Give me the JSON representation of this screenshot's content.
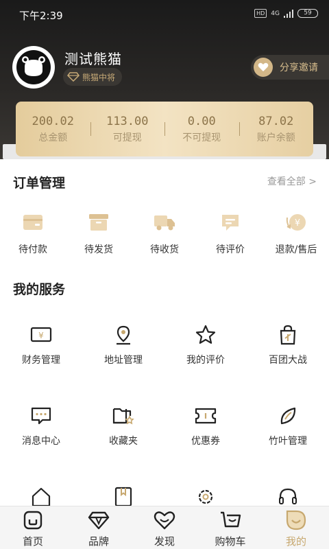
{
  "status_bar": {
    "time": "下午2:39",
    "hd": "HD",
    "network": "4G",
    "battery": "59"
  },
  "profile": {
    "username": "测试熊猫",
    "rank": "熊猫中将",
    "invite_label": "分享邀请"
  },
  "wallet": [
    {
      "value": "200.02",
      "label": "总金额"
    },
    {
      "value": "113.00",
      "label": "可提现"
    },
    {
      "value": "0.00",
      "label": "不可提现"
    },
    {
      "value": "87.02",
      "label": "账户余额"
    }
  ],
  "orders": {
    "title": "订单管理",
    "view_all": "查看全部 >",
    "items": [
      {
        "label": "待付款",
        "icon": "wallet-icon"
      },
      {
        "label": "待发货",
        "icon": "box-icon"
      },
      {
        "label": "待收货",
        "icon": "truck-icon"
      },
      {
        "label": "待评价",
        "icon": "comment-icon"
      },
      {
        "label": "退款/售后",
        "icon": "refund-icon"
      }
    ]
  },
  "services": {
    "title": "我的服务",
    "items": [
      {
        "label": "财务管理",
        "icon": "finance-icon"
      },
      {
        "label": "地址管理",
        "icon": "location-pin-icon"
      },
      {
        "label": "我的评价",
        "icon": "star-icon"
      },
      {
        "label": "百团大战",
        "icon": "shopping-bag-icon"
      },
      {
        "label": "消息中心",
        "icon": "message-icon"
      },
      {
        "label": "收藏夹",
        "icon": "folder-star-icon"
      },
      {
        "label": "优惠券",
        "icon": "coupon-icon"
      },
      {
        "label": "竹叶管理",
        "icon": "leaf-icon"
      }
    ]
  },
  "nav": [
    {
      "label": "首页",
      "icon": "home-icon",
      "active": false
    },
    {
      "label": "品牌",
      "icon": "diamond-icon",
      "active": false
    },
    {
      "label": "发现",
      "icon": "heart-icon",
      "active": false
    },
    {
      "label": "购物车",
      "icon": "cart-icon",
      "active": false
    },
    {
      "label": "我的",
      "icon": "profile-icon",
      "active": true
    }
  ],
  "colors": {
    "accent": "#c7a86f",
    "header_dark": "#1a1a1a",
    "card_gold": "#e9d4a8"
  }
}
